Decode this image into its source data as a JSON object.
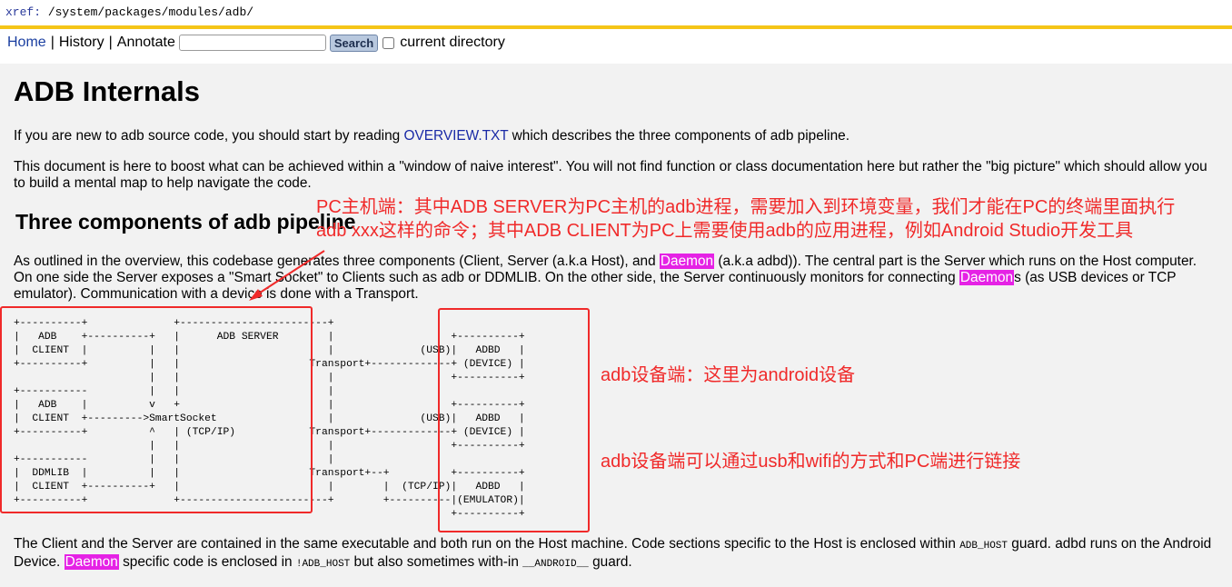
{
  "xref": {
    "label": "xref:",
    "path": " /system/packages/modules/adb/"
  },
  "nav": {
    "home": "Home",
    "history": "History",
    "annotate": "Annotate",
    "separator": "|",
    "search_value": "",
    "search_button": "Search",
    "current_directory": "current directory"
  },
  "doc": {
    "title": "ADB Internals",
    "p1_before": "If you are new to adb source code, you should start by reading ",
    "p1_link": "OVERVIEW.TXT",
    "p1_after": " which describes the three components of adb pipeline.",
    "p2": "This document is here to boost what can be achieved within a \"window of naive interest\". You will not find function or class documentation here but rather the \"big picture\" which should allow you to build a mental map to help navigate the code.",
    "h2": "Three components of adb pipeline",
    "p3_a": "As outlined in the overview, this codebase generates three components (Client, Server (a.k.a Host), and ",
    "p3_hl1": "Daemon",
    "p3_b": " (a.k.a adbd)). The central part is the Server which runs on the Host computer. On one side the Server exposes a \"Smart Socket\" to Clients such as adb or DDMLIB. On the other side, the Server continuously monitors for connecting ",
    "p3_hl2": "Daemon",
    "p3_c": "s (as USB devices or TCP emulator). Communication with a device is done with a Transport.",
    "diagram": "+----------+              +------------------------+\n|   ADB    +----------+   |      ADB SERVER        |                   +----------+\n|  CLIENT  |          |   |                        |              (USB)|   ADBD   |\n+----------+          |   |                     Transport+-------------+ (DEVICE) |\n                      |   |                        |                   +----------+\n+-----------          |   |                        |\n|   ADB    |          v   +                        |                   +----------+\n|  CLIENT  +--------->SmartSocket                  |              (USB)|   ADBD   |\n+----------+          ^   | (TCP/IP)            Transport+-------------+ (DEVICE) |\n                      |   |                        |                   +----------+\n+-----------          |   |                        |\n|  DDMLIB  |          |   |                     Transport+--+          +----------+\n|  CLIENT  +----------+   |                        |        |  (TCP/IP)|   ADBD   |\n+----------+              +------------------------+        +----------|(EMULATOR)|\n                                                                       +----------+",
    "p4_a": "The Client and the Server are contained in the same executable and both run on the Host machine. Code sections specific to the Host is enclosed within ",
    "p4_code1": "ADB_HOST",
    "p4_b": " guard. adbd runs on the Android Device. ",
    "p4_hl": "Daemon",
    "p4_c": " specific code is enclosed in ",
    "p4_code2": "!ADB_HOST",
    "p4_d": " but also sometimes with-in ",
    "p4_code3": "__ANDROID__",
    "p4_e": " guard."
  },
  "annotations": {
    "host": "PC主机端：其中ADB SERVER为PC主机的adb进程，需要加入到环境变量，我们才能在PC的终端里面执行\nadb xxx这样的命令；其中ADB CLIENT为PC上需要使用adb的应用进程，例如Android Studio开发工具",
    "device": "adb设备端：这里为android设备",
    "link": "adb设备端可以通过usb和wifi的方式和PC端进行链接"
  },
  "colors": {
    "annotation": "#f02a2a",
    "highlight": "#e522e5",
    "bar": "#f5c518",
    "link": "#1a3ea0"
  }
}
